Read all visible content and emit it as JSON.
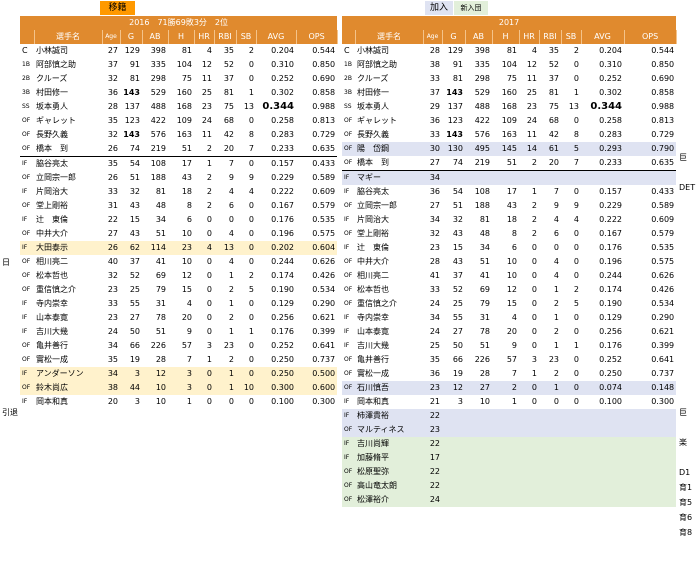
{
  "labels": {
    "transfer": "移籍",
    "added": "加入",
    "new_entry": "新入団",
    "year_left": "2016　71勝69敗3分　2位",
    "year_right": "2017"
  },
  "columns": [
    "",
    "選手名",
    "Age",
    "G",
    "AB",
    "H",
    "HR",
    "RBI",
    "SB",
    "AVG",
    "OPS"
  ],
  "left": [
    [
      "C",
      "小林誠司",
      "27",
      "129",
      "398",
      "81",
      "4",
      "35",
      "2",
      "0.204",
      "0.544",
      "",
      "",
      ""
    ],
    [
      "1B",
      "阿部慎之助",
      "37",
      "91",
      "335",
      "104",
      "12",
      "52",
      "0",
      "0.310",
      "0.850",
      "",
      "",
      ""
    ],
    [
      "2B",
      "クルーズ",
      "32",
      "81",
      "298",
      "75",
      "11",
      "37",
      "0",
      "0.252",
      "0.690",
      "",
      "",
      ""
    ],
    [
      "3B",
      "村田修一",
      "36",
      "143",
      "529",
      "160",
      "25",
      "81",
      "1",
      "0.302",
      "0.858",
      "",
      "",
      ""
    ],
    [
      "SS",
      "坂本勇人",
      "28",
      "137",
      "488",
      "168",
      "23",
      "75",
      "13",
      "0.344",
      "0.988",
      "",
      "",
      ""
    ],
    [
      "OF",
      "ギャレット",
      "35",
      "123",
      "422",
      "109",
      "24",
      "68",
      "0",
      "0.258",
      "0.813",
      "",
      "",
      ""
    ],
    [
      "OF",
      "長野久義",
      "32",
      "143",
      "576",
      "163",
      "11",
      "42",
      "8",
      "0.283",
      "0.729",
      "",
      "",
      ""
    ],
    [
      "OF",
      "橋本　到",
      "26",
      "74",
      "219",
      "51",
      "2",
      "20",
      "7",
      "0.233",
      "0.635",
      "",
      "",
      ""
    ],
    [
      "IF",
      "脇谷亮太",
      "35",
      "54",
      "108",
      "17",
      "1",
      "7",
      "0",
      "0.157",
      "0.433",
      "",
      "",
      ""
    ],
    [
      "OF",
      "立岡宗一郎",
      "26",
      "51",
      "188",
      "43",
      "2",
      "9",
      "9",
      "0.229",
      "0.589",
      "",
      "",
      ""
    ],
    [
      "IF",
      "片岡治大",
      "33",
      "32",
      "81",
      "18",
      "2",
      "4",
      "4",
      "0.222",
      "0.609",
      "",
      "",
      ""
    ],
    [
      "OF",
      "堂上剛裕",
      "31",
      "43",
      "48",
      "8",
      "2",
      "6",
      "0",
      "0.167",
      "0.579",
      "",
      "",
      ""
    ],
    [
      "IF",
      "辻　東倫",
      "22",
      "15",
      "34",
      "6",
      "0",
      "0",
      "0",
      "0.176",
      "0.535",
      "",
      "",
      ""
    ],
    [
      "OF",
      "中井大介",
      "27",
      "43",
      "51",
      "10",
      "0",
      "4",
      "0",
      "0.196",
      "0.575",
      "",
      "",
      ""
    ],
    [
      "IF",
      "大田泰示",
      "26",
      "62",
      "114",
      "23",
      "4",
      "13",
      "0",
      "0.202",
      "0.604",
      "yellow",
      "日",
      ""
    ],
    [
      "OF",
      "相川亮二",
      "40",
      "37",
      "41",
      "10",
      "0",
      "4",
      "0",
      "0.244",
      "0.626",
      "",
      "",
      ""
    ],
    [
      "OF",
      "松本哲也",
      "32",
      "52",
      "69",
      "12",
      "0",
      "1",
      "2",
      "0.174",
      "0.426",
      "",
      "",
      ""
    ],
    [
      "OF",
      "重信慎之介",
      "23",
      "25",
      "79",
      "15",
      "0",
      "2",
      "5",
      "0.190",
      "0.534",
      "",
      "",
      ""
    ],
    [
      "IF",
      "寺内崇幸",
      "33",
      "55",
      "31",
      "4",
      "0",
      "1",
      "0",
      "0.129",
      "0.290",
      "",
      "",
      ""
    ],
    [
      "IF",
      "山本泰寛",
      "23",
      "27",
      "78",
      "20",
      "0",
      "2",
      "0",
      "0.256",
      "0.621",
      "",
      "",
      ""
    ],
    [
      "IF",
      "吉川大幾",
      "24",
      "50",
      "51",
      "9",
      "0",
      "1",
      "1",
      "0.176",
      "0.399",
      "",
      "",
      ""
    ],
    [
      "OF",
      "亀井善行",
      "34",
      "66",
      "226",
      "57",
      "3",
      "23",
      "0",
      "0.252",
      "0.641",
      "",
      "",
      ""
    ],
    [
      "OF",
      "實松一成",
      "35",
      "19",
      "28",
      "7",
      "1",
      "2",
      "0",
      "0.250",
      "0.737",
      "",
      "",
      ""
    ],
    [
      "IF",
      "アンダーソン",
      "34",
      "3",
      "12",
      "3",
      "0",
      "1",
      "0",
      "0.250",
      "0.500",
      "yellow",
      "",
      ""
    ],
    [
      "OF",
      "鈴木尚広",
      "38",
      "44",
      "10",
      "3",
      "0",
      "1",
      "10",
      "0.300",
      "0.600",
      "yellow",
      "引退",
      ""
    ],
    [
      "IF",
      "岡本和真",
      "20",
      "3",
      "10",
      "1",
      "0",
      "0",
      "0",
      "0.100",
      "0.300",
      "",
      "",
      ""
    ]
  ],
  "right": [
    [
      "C",
      "小林誠司",
      "28",
      "129",
      "398",
      "81",
      "4",
      "35",
      "2",
      "0.204",
      "0.544",
      "",
      "",
      ""
    ],
    [
      "1B",
      "阿部慎之助",
      "38",
      "91",
      "335",
      "104",
      "12",
      "52",
      "0",
      "0.310",
      "0.850",
      "",
      "",
      ""
    ],
    [
      "2B",
      "クルーズ",
      "33",
      "81",
      "298",
      "75",
      "11",
      "37",
      "0",
      "0.252",
      "0.690",
      "",
      "",
      ""
    ],
    [
      "3B",
      "村田修一",
      "37",
      "143",
      "529",
      "160",
      "25",
      "81",
      "1",
      "0.302",
      "0.858",
      "",
      "",
      ""
    ],
    [
      "SS",
      "坂本勇人",
      "29",
      "137",
      "488",
      "168",
      "23",
      "75",
      "13",
      "0.344",
      "0.988",
      "",
      "",
      ""
    ],
    [
      "OF",
      "ギャレット",
      "36",
      "123",
      "422",
      "109",
      "24",
      "68",
      "0",
      "0.258",
      "0.813",
      "",
      "",
      ""
    ],
    [
      "OF",
      "長野久義",
      "33",
      "143",
      "576",
      "163",
      "11",
      "42",
      "8",
      "0.283",
      "0.729",
      "",
      "",
      ""
    ],
    [
      "OF",
      "陽　岱鋼",
      "30",
      "130",
      "495",
      "145",
      "14",
      "61",
      "5",
      "0.293",
      "0.790",
      "blue",
      "",
      "巨"
    ],
    [
      "OF",
      "橋本　到",
      "27",
      "74",
      "219",
      "51",
      "2",
      "20",
      "7",
      "0.233",
      "0.635",
      "",
      "",
      ""
    ],
    [
      "IF",
      "マギー",
      "34",
      "",
      "",
      "",
      "",
      "",
      "",
      "",
      "",
      "blue",
      "",
      "DET"
    ],
    [
      "IF",
      "脇谷亮太",
      "36",
      "54",
      "108",
      "17",
      "1",
      "7",
      "0",
      "0.157",
      "0.433",
      "",
      "",
      ""
    ],
    [
      "OF",
      "立岡宗一郎",
      "27",
      "51",
      "188",
      "43",
      "2",
      "9",
      "9",
      "0.229",
      "0.589",
      "",
      "",
      ""
    ],
    [
      "IF",
      "片岡治大",
      "34",
      "32",
      "81",
      "18",
      "2",
      "4",
      "4",
      "0.222",
      "0.609",
      "",
      "",
      ""
    ],
    [
      "OF",
      "堂上剛裕",
      "32",
      "43",
      "48",
      "8",
      "2",
      "6",
      "0",
      "0.167",
      "0.579",
      "",
      "",
      ""
    ],
    [
      "IF",
      "辻　東倫",
      "23",
      "15",
      "34",
      "6",
      "0",
      "0",
      "0",
      "0.176",
      "0.535",
      "",
      "",
      ""
    ],
    [
      "OF",
      "中井大介",
      "28",
      "43",
      "51",
      "10",
      "0",
      "4",
      "0",
      "0.196",
      "0.575",
      "",
      "",
      ""
    ],
    [
      "OF",
      "相川亮二",
      "41",
      "37",
      "41",
      "10",
      "0",
      "4",
      "0",
      "0.244",
      "0.626",
      "",
      "",
      ""
    ],
    [
      "OF",
      "松本哲也",
      "33",
      "52",
      "69",
      "12",
      "0",
      "1",
      "2",
      "0.174",
      "0.426",
      "",
      "",
      ""
    ],
    [
      "OF",
      "重信慎之介",
      "24",
      "25",
      "79",
      "15",
      "0",
      "2",
      "5",
      "0.190",
      "0.534",
      "",
      "",
      ""
    ],
    [
      "IF",
      "寺内崇幸",
      "34",
      "55",
      "31",
      "4",
      "0",
      "1",
      "0",
      "0.129",
      "0.290",
      "",
      "",
      ""
    ],
    [
      "IF",
      "山本泰寛",
      "24",
      "27",
      "78",
      "20",
      "0",
      "2",
      "0",
      "0.256",
      "0.621",
      "",
      "",
      ""
    ],
    [
      "IF",
      "吉川大幾",
      "25",
      "50",
      "51",
      "9",
      "0",
      "1",
      "1",
      "0.176",
      "0.399",
      "",
      "",
      ""
    ],
    [
      "OF",
      "亀井善行",
      "35",
      "66",
      "226",
      "57",
      "3",
      "23",
      "0",
      "0.252",
      "0.641",
      "",
      "",
      ""
    ],
    [
      "OF",
      "實松一成",
      "36",
      "19",
      "28",
      "7",
      "1",
      "2",
      "0",
      "0.250",
      "0.737",
      "",
      "",
      ""
    ],
    [
      "OF",
      "石川慎吾",
      "23",
      "12",
      "27",
      "2",
      "0",
      "1",
      "0",
      "0.074",
      "0.148",
      "blue",
      "",
      "巨"
    ],
    [
      "IF",
      "岡本和真",
      "21",
      "3",
      "10",
      "1",
      "0",
      "0",
      "0",
      "0.100",
      "0.300",
      "",
      "",
      ""
    ],
    [
      "IF",
      "柿澤貴裕",
      "22",
      "",
      "",
      "",
      "",
      "",
      "",
      "",
      "",
      "blue",
      "",
      "楽"
    ],
    [
      "OF",
      "マルティネス",
      "23",
      "",
      "",
      "",
      "",
      "",
      "",
      "",
      "",
      "blue",
      "",
      ""
    ],
    [
      "IF",
      "吉川尚輝",
      "22",
      "",
      "",
      "",
      "",
      "",
      "",
      "",
      "",
      "green",
      "",
      "D1"
    ],
    [
      "IF",
      "加藤脩平",
      "17",
      "",
      "",
      "",
      "",
      "",
      "",
      "",
      "",
      "green",
      "",
      "育1"
    ],
    [
      "OF",
      "松原聖弥",
      "22",
      "",
      "",
      "",
      "",
      "",
      "",
      "",
      "",
      "green",
      "",
      "育5"
    ],
    [
      "OF",
      "高山竜太朗",
      "22",
      "",
      "",
      "",
      "",
      "",
      "",
      "",
      "",
      "green",
      "",
      "育6"
    ],
    [
      "OF",
      "松澤裕介",
      "24",
      "",
      "",
      "",
      "",
      "",
      "",
      "",
      "",
      "green",
      "",
      "育8"
    ]
  ]
}
